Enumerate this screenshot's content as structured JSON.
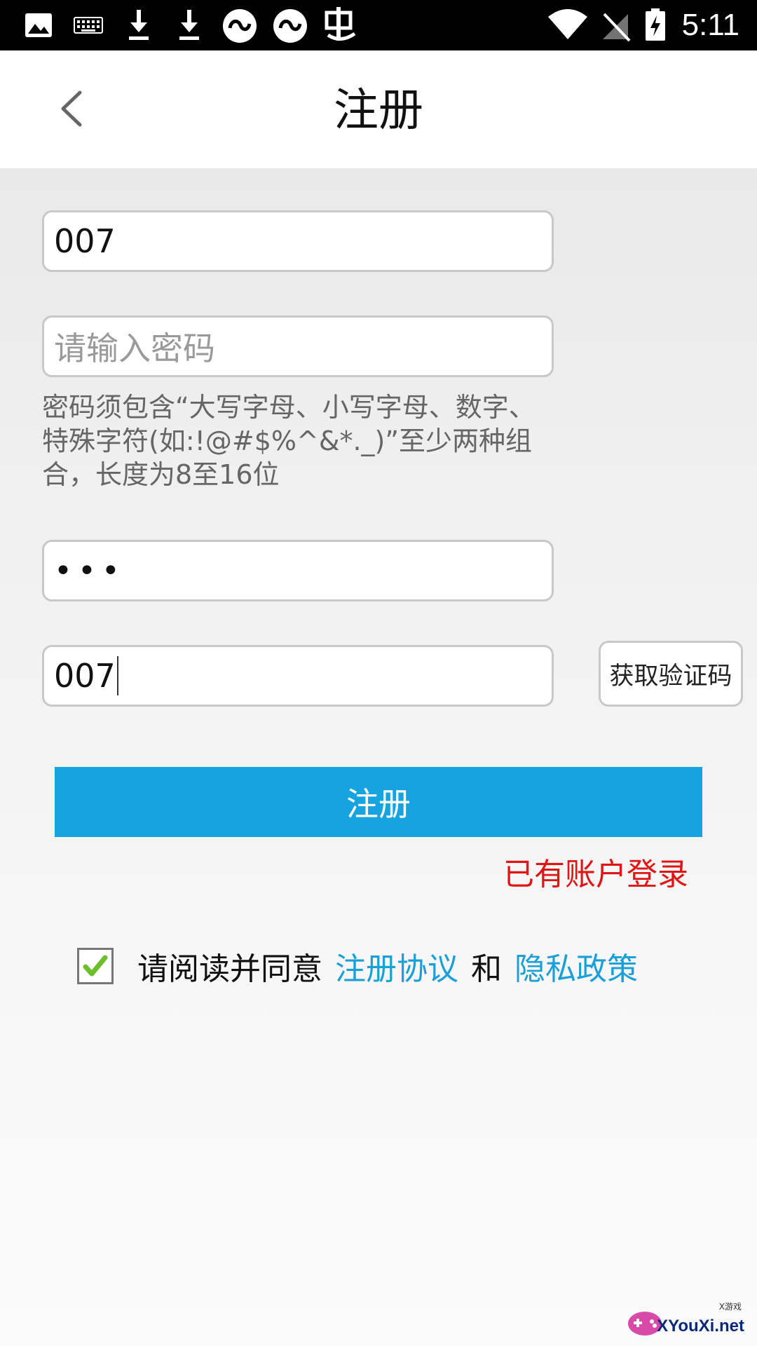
{
  "status_bar": {
    "time": "5:11",
    "left_icons": [
      "image-icon",
      "keyboard-icon",
      "download-icon",
      "download-icon",
      "app-badge-icon",
      "app-badge-icon",
      "app-glyph-icon"
    ],
    "right_icons": [
      "wifi-icon",
      "no-signal-icon",
      "battery-charging-icon"
    ]
  },
  "header": {
    "title": "注册",
    "back_icon": "chevron-left-icon"
  },
  "form": {
    "username_value": "007",
    "password_placeholder": "请输入密码",
    "password_hint": "密码须包含“大写字母、小写字母、数字、特殊字符(如:!@#$%^&*._)”至少两种组合，长度为8至16位",
    "confirm_masked": "•••",
    "code_value": "007",
    "get_code_label": "获取验证码"
  },
  "submit_label": "注册",
  "login_link": "已有账户登录",
  "agreement": {
    "checked": true,
    "prefix": "请阅读并同意",
    "terms_link": "注册协议",
    "and_text": "和",
    "privacy_link": "隐私政策"
  },
  "watermark": {
    "text": "XYouXi.net",
    "small_text": "X游戏"
  },
  "colors": {
    "primary": "#16a3df",
    "link": "#1a9fd9",
    "danger": "#e01616",
    "check": "#6cbf2b"
  }
}
